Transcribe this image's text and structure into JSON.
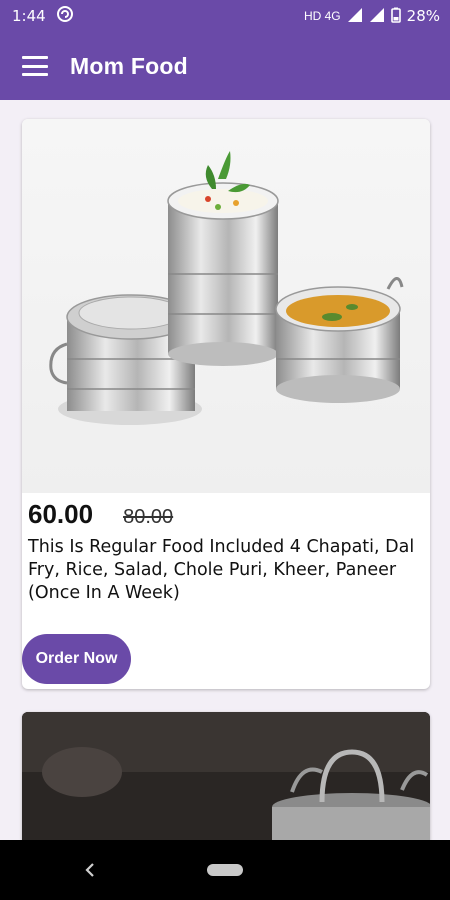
{
  "status_bar": {
    "time": "1:44",
    "network": "HD 4G",
    "battery": "28%"
  },
  "app_bar": {
    "title": "Mom Food"
  },
  "cards": [
    {
      "price": "60.00",
      "old_price": "80.00",
      "description": "This Is Regular Food Included 4 Chapati, Dal Fry, Rice, Salad, Chole Puri, Kheer, Paneer (Once In A Week)",
      "button_label": "Order Now"
    }
  ],
  "colors": {
    "primary": "#6a4aa8",
    "nav_bar": "#000000"
  }
}
